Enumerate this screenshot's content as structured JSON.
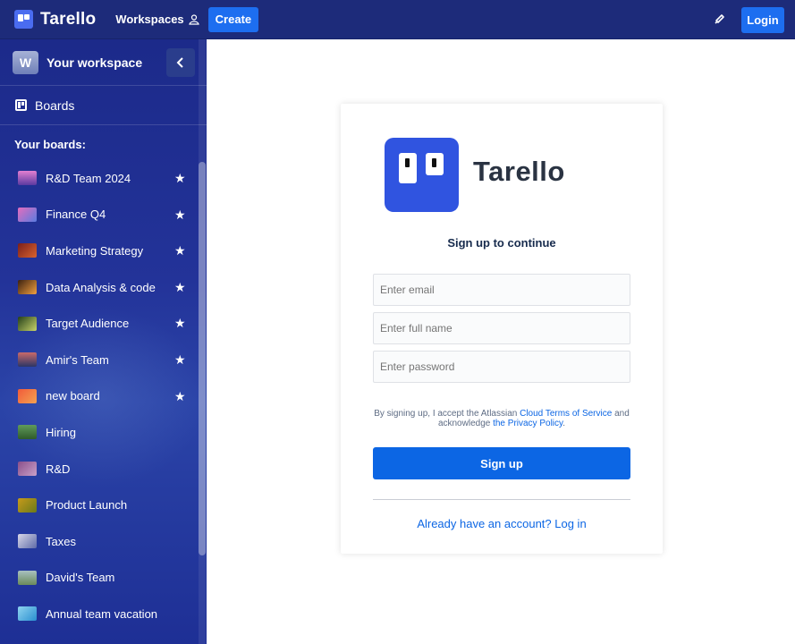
{
  "topbar": {
    "brand": "Tarello",
    "workspaces_label": "Workspaces",
    "create_label": "Create",
    "login_label": "Login"
  },
  "sidebar": {
    "workspace_initial": "W",
    "workspace_title": "Your workspace",
    "boards_label": "Boards",
    "your_boards_label": "Your boards:",
    "boards": [
      {
        "name": "R&D Team 2024",
        "starred": true
      },
      {
        "name": "Finance Q4",
        "starred": true
      },
      {
        "name": "Marketing Strategy",
        "starred": true
      },
      {
        "name": "Data Analysis & code",
        "starred": true
      },
      {
        "name": "Target Audience",
        "starred": true
      },
      {
        "name": "Amir's Team",
        "starred": true
      },
      {
        "name": "new board",
        "starred": true
      },
      {
        "name": "Hiring",
        "starred": false
      },
      {
        "name": "R&D",
        "starred": false
      },
      {
        "name": "Product Launch",
        "starred": false
      },
      {
        "name": "Taxes",
        "starred": false
      },
      {
        "name": "David's Team",
        "starred": false
      },
      {
        "name": "Annual team vacation",
        "starred": false
      }
    ]
  },
  "signup": {
    "logo_text": "Tarello",
    "title": "Sign up to continue",
    "email_placeholder": "Enter email",
    "fullname_placeholder": "Enter full name",
    "password_placeholder": "Enter password",
    "terms_prefix": "By signing up, I accept the Atlassian",
    "terms_link": "Cloud Terms of Service",
    "terms_mid": "and acknowledge",
    "privacy_link": "the Privacy Policy",
    "signup_label": "Sign up",
    "login_link": "Already have an account? Log in"
  },
  "colors": {
    "topbar_bg": "#1d2b7a",
    "primary_button": "#0c66e4",
    "logo_blue": "#3054e0"
  }
}
